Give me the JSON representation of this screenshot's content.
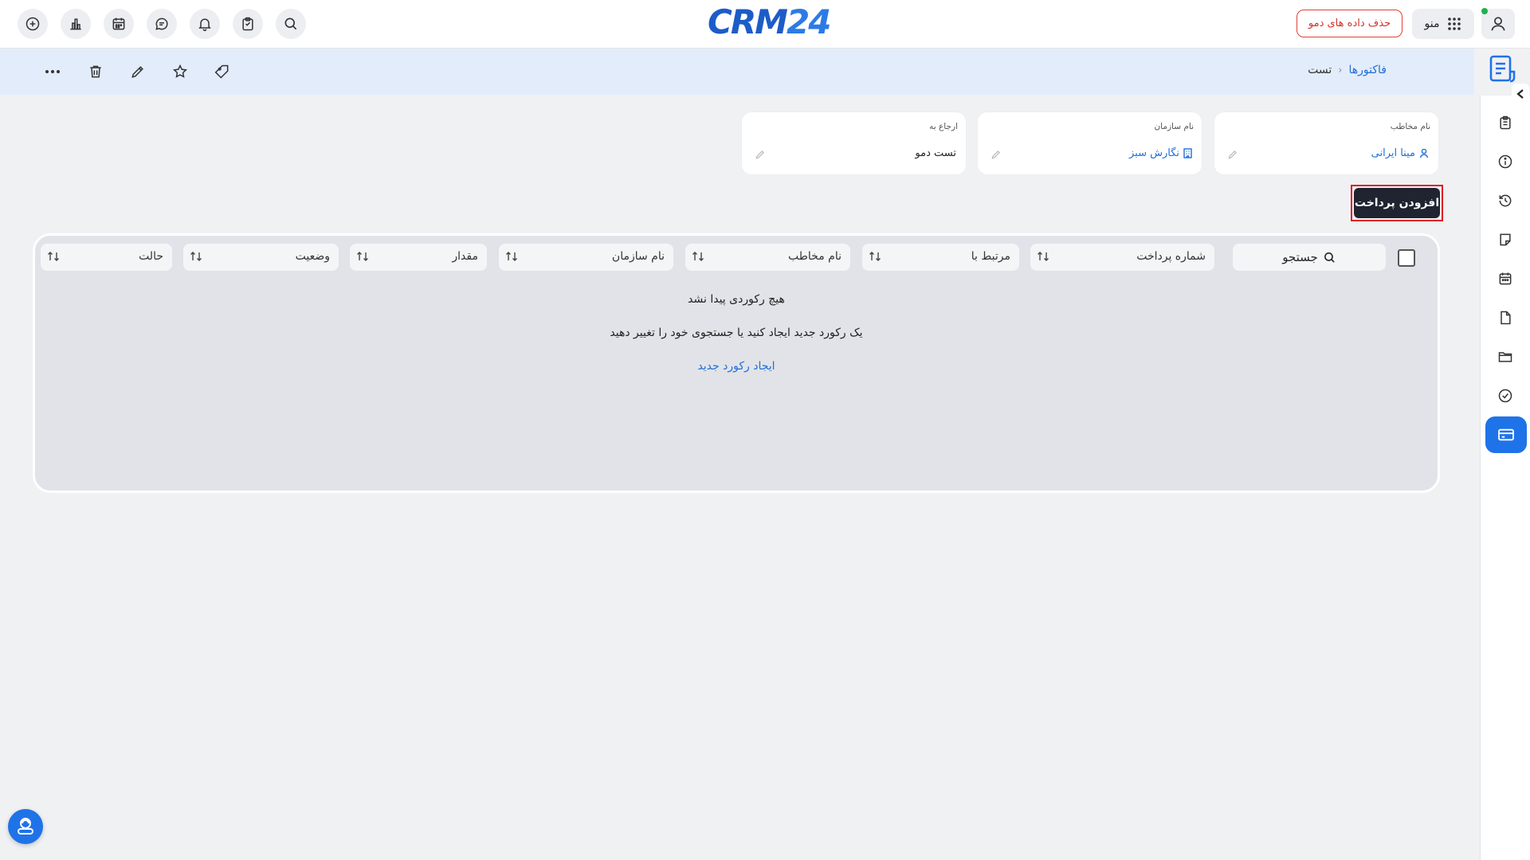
{
  "header": {
    "logo": {
      "part1": "CRM",
      "part2": "24"
    },
    "demo_button": "حذف داده های دمو",
    "menu_label": "منو",
    "colors": {
      "accent": "#1f73e8",
      "danger": "#e0413a",
      "logo_dark": "#1d5cc8"
    },
    "icons": [
      "add-icon",
      "chart-icon",
      "calendar-icon",
      "chat-icon",
      "bell-icon",
      "clipboard-icon",
      "search-icon",
      "grid-icon",
      "user-icon"
    ]
  },
  "breadcrumb": {
    "parent": "فاکتورها",
    "separator": "‹",
    "current": "تست"
  },
  "toolbar_icons": [
    "more-icon",
    "trash-icon",
    "pencil-icon",
    "star-icon",
    "tag-icon"
  ],
  "fields": [
    {
      "label": "نام مخاطب",
      "value": "مینا ایرانی",
      "icon": "person-icon"
    },
    {
      "label": "نام سازمان",
      "value": "نگارش سبز",
      "icon": "building-icon"
    },
    {
      "label": "ارجاع به",
      "value": "تست دمو"
    }
  ],
  "add_payment_button": "افزودن پرداخت",
  "table": {
    "search_label": "جستجو",
    "columns": [
      "شماره پرداخت",
      "مرتبط با",
      "نام مخاطب",
      "نام سازمان",
      "مقدار",
      "وضعیت",
      "حالت"
    ],
    "empty_title": "هیچ رکوردی پیدا نشد",
    "empty_subtitle": "یک رکورد جدید ایجاد کنید یا جستجوی خود را تغییر دهید",
    "empty_action": "ایجاد رکورد جدید"
  },
  "sidebar_icons": [
    "clipboard-icon",
    "info-icon",
    "history-icon",
    "note-icon",
    "calendar-icon",
    "document-icon",
    "folder-icon",
    "check-circle-icon",
    "card-icon"
  ]
}
